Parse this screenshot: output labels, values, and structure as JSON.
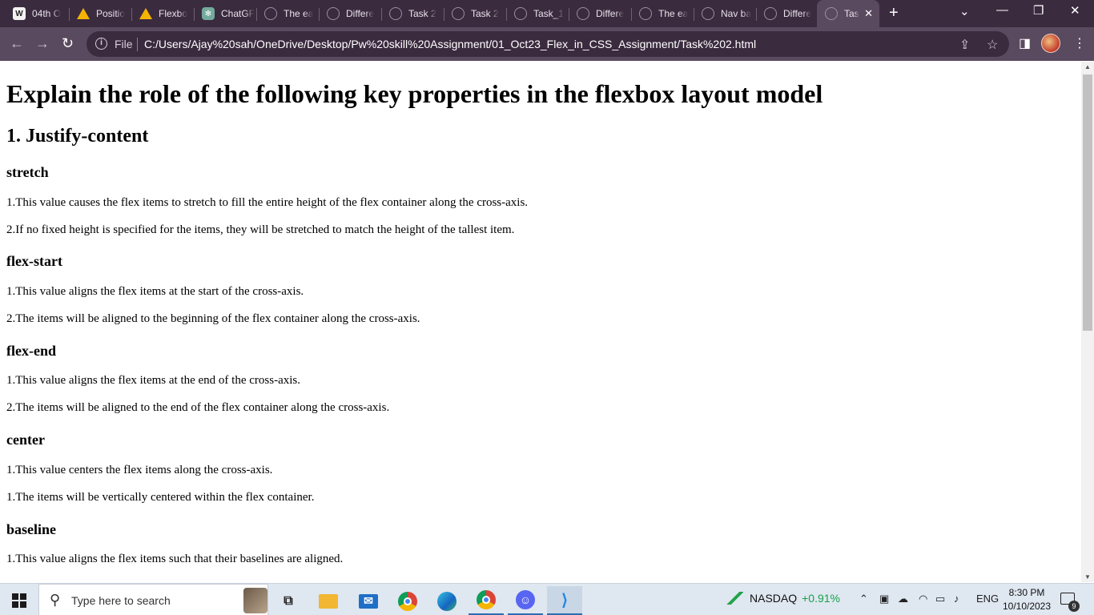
{
  "browser": {
    "tabs": [
      {
        "label": "04th O",
        "icon": "pw-skills-icon"
      },
      {
        "label": "Positio",
        "icon": "google-drive-icon"
      },
      {
        "label": "Flexbo",
        "icon": "google-drive-icon"
      },
      {
        "label": "ChatGF",
        "icon": "chatgpt-icon"
      },
      {
        "label": "The ea",
        "icon": "globe-icon"
      },
      {
        "label": "Differe",
        "icon": "globe-icon"
      },
      {
        "label": "Task 2",
        "icon": "globe-icon"
      },
      {
        "label": "Task 2",
        "icon": "globe-icon"
      },
      {
        "label": "Task_1",
        "icon": "globe-icon"
      },
      {
        "label": "Differe",
        "icon": "globe-icon"
      },
      {
        "label": "The ea",
        "icon": "globe-icon"
      },
      {
        "label": "Nav ba",
        "icon": "globe-icon"
      },
      {
        "label": "Differe",
        "icon": "globe-icon"
      },
      {
        "label": "Tas",
        "icon": "globe-icon",
        "active": true
      }
    ],
    "new_tab_label": "+",
    "window_controls": {
      "minimize": "—",
      "restore": "❐",
      "close": "✕",
      "tab_search": "⌄"
    },
    "address": {
      "file_label": "File",
      "url": "C:/Users/Ajay%20sah/OneDrive/Desktop/Pw%20skill%20Assignment/01_Oct23_Flex_in_CSS_Assignment/Task%202.html"
    }
  },
  "page": {
    "title": "Explain the role of the following key properties in the flexbox layout model",
    "section": "1. Justify-content",
    "blocks": [
      {
        "heading": "stretch",
        "lines": [
          "1.This value causes the flex items to stretch to fill the entire height of the flex container along the cross-axis.",
          "2.If no fixed height is specified for the items, they will be stretched to match the height of the tallest item."
        ]
      },
      {
        "heading": "flex-start",
        "lines": [
          "1.This value aligns the flex items at the start of the cross-axis.",
          "2.The items will be aligned to the beginning of the flex container along the cross-axis."
        ]
      },
      {
        "heading": "flex-end",
        "lines": [
          "1.This value aligns the flex items at the end of the cross-axis.",
          "2.The items will be aligned to the end of the flex container along the cross-axis."
        ]
      },
      {
        "heading": "center",
        "lines": [
          "1.This value centers the flex items along the cross-axis.",
          "1.The items will be vertically centered within the flex container."
        ]
      },
      {
        "heading": "baseline",
        "lines": [
          "1.This value aligns the flex items such that their baselines are aligned."
        ]
      }
    ]
  },
  "taskbar": {
    "search_placeholder": "Type here to search",
    "apps": [
      "task-view-icon",
      "file-explorer-icon",
      "mail-icon",
      "chrome-icon",
      "edge-icon",
      "chrome-profile-icon",
      "discord-icon",
      "vscode-icon"
    ],
    "stock": {
      "name": "NASDAQ",
      "change": "+0.91%"
    },
    "language": "ENG",
    "time": "8:30 PM",
    "date": "10/10/2023",
    "notification_count": "9"
  }
}
